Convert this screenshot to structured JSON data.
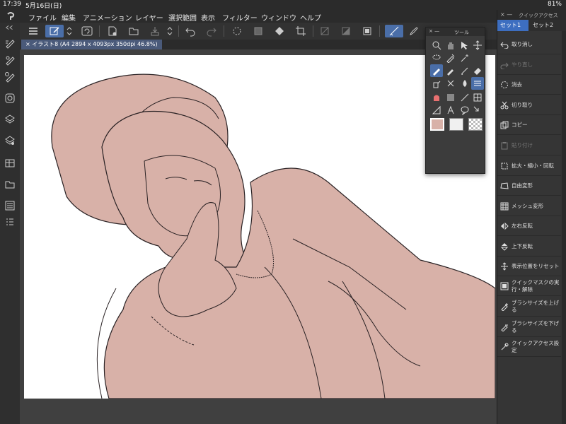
{
  "status": {
    "time": "17:39",
    "date": "5月16日(日)",
    "battery": "81%"
  },
  "menubar": {
    "items": [
      "ファイル",
      "編集",
      "アニメーション",
      "レイヤー",
      "選択範囲",
      "表示",
      "フィルター",
      "ウィンドウ",
      "ヘルプ"
    ]
  },
  "document": {
    "tab_label": "イラスト8 (A4 2894 x 4093px 350dpi 46.8%)"
  },
  "tool_palette": {
    "title": "ツール"
  },
  "quick_access": {
    "title": "クイックアクセス",
    "tabs": [
      "セット1",
      "セット2"
    ],
    "active_tab": "セット1",
    "items": [
      {
        "label": "取り消し",
        "icon": "undo-icon",
        "enabled": true
      },
      {
        "label": "やり直し",
        "icon": "redo-icon",
        "enabled": false
      },
      {
        "label": "消去",
        "icon": "clear-icon",
        "enabled": true
      },
      {
        "label": "切り取り",
        "icon": "scissors-icon",
        "enabled": true
      },
      {
        "label": "コピー",
        "icon": "copy-icon",
        "enabled": true
      },
      {
        "label": "貼り付け",
        "icon": "paste-icon",
        "enabled": false
      },
      {
        "label": "拡大・縮小・回転",
        "icon": "scale-rotate-icon",
        "enabled": true
      },
      {
        "label": "自由変形",
        "icon": "free-transform-icon",
        "enabled": true
      },
      {
        "label": "メッシュ変形",
        "icon": "mesh-transform-icon",
        "enabled": true
      },
      {
        "label": "左右反転",
        "icon": "flip-horizontal-icon",
        "enabled": true
      },
      {
        "label": "上下反転",
        "icon": "flip-vertical-icon",
        "enabled": true
      },
      {
        "label": "表示位置をリセット",
        "icon": "reset-position-icon",
        "enabled": true
      },
      {
        "label": "クイックマスクの実行・解除",
        "icon": "quick-mask-icon",
        "enabled": true
      },
      {
        "label": "ブラシサイズを上げる",
        "icon": "brush-size-up-icon",
        "enabled": true
      },
      {
        "label": "ブラシサイズを下げる",
        "icon": "brush-size-down-icon",
        "enabled": true
      },
      {
        "label": "クイックアクセス設定",
        "icon": "settings-icon",
        "enabled": true
      }
    ]
  },
  "colors": {
    "accent": "#3d6ec0",
    "main_color": "#d8b1a8",
    "sub_color": "#f0f0f0",
    "artwork_fill": "#d8b1a8",
    "line": "#2a2224"
  }
}
